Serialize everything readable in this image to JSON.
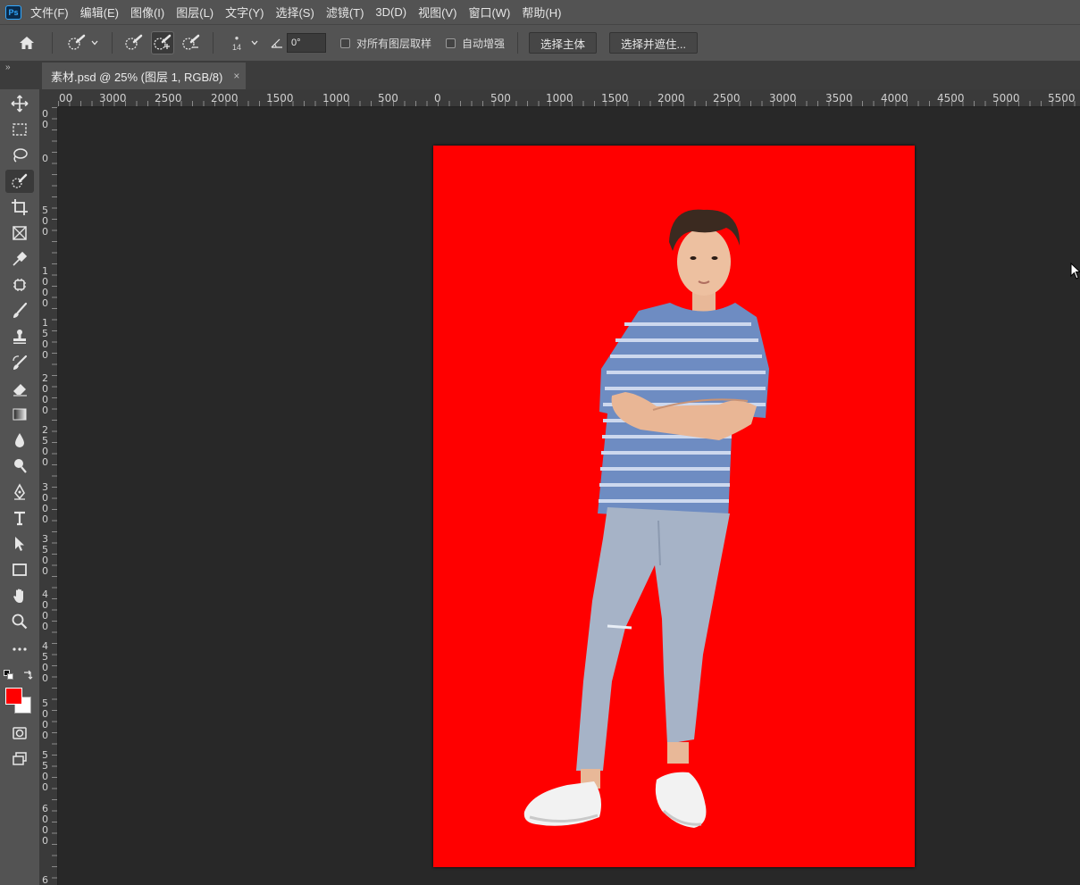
{
  "app": {
    "logo_text": "Ps"
  },
  "menu": [
    "文件(F)",
    "编辑(E)",
    "图像(I)",
    "图层(L)",
    "文字(Y)",
    "选择(S)",
    "滤镜(T)",
    "3D(D)",
    "视图(V)",
    "窗口(W)",
    "帮助(H)"
  ],
  "options": {
    "brush_size": "14",
    "angle_value": "0°",
    "sample_all_layers_label": "对所有图层取样",
    "sample_all_layers_checked": false,
    "auto_enhance_label": "自动增强",
    "auto_enhance_checked": false,
    "select_subject_label": "选择主体",
    "select_and_mask_label": "选择并遮住..."
  },
  "panel_toggle": "»",
  "document_tab": {
    "title": "素材.psd @ 25% (图层 1, RGB/8)",
    "close": "×"
  },
  "rulers": {
    "horizontal_labels": [
      "00",
      "3000",
      "2500",
      "2000",
      "1500",
      "1000",
      "500",
      "0",
      "500",
      "1000",
      "1500",
      "2000",
      "2500",
      "3000",
      "3500",
      "4000",
      "4500",
      "5000",
      "5500"
    ],
    "vertical_digits": [
      "0",
      "0",
      "0",
      "5",
      "0",
      "0",
      "1",
      "0",
      "0",
      "0",
      "1",
      "5",
      "0",
      "0",
      "2",
      "0",
      "0",
      "0",
      "2",
      "5",
      "0",
      "0",
      "3",
      "0",
      "0",
      "0",
      "3",
      "5",
      "0",
      "0",
      "4",
      "0",
      "0",
      "0",
      "4",
      "5",
      "0",
      "0",
      "5",
      "0",
      "0",
      "0",
      "5",
      "5",
      "0",
      "0",
      "6",
      "0",
      "0",
      "0",
      "6"
    ]
  },
  "colors": {
    "foreground": "#ff0000",
    "background": "#ffffff",
    "canvas_fill": "#ff0000"
  },
  "tools": [
    "move-icon",
    "marquee-icon",
    "lasso-icon",
    "quick-selection-icon",
    "crop-icon",
    "frame-icon",
    "eyedropper-icon",
    "healing-brush-icon",
    "brush-icon",
    "clone-stamp-icon",
    "history-brush-icon",
    "eraser-icon",
    "gradient-icon",
    "blur-icon",
    "dodge-icon",
    "pen-icon",
    "type-icon",
    "path-selection-icon",
    "rectangle-icon",
    "hand-icon",
    "zoom-icon",
    "more-tools-icon",
    "default-colors-icon",
    "swap-colors-icon",
    "quick-mask-icon",
    "screen-mode-icon"
  ]
}
